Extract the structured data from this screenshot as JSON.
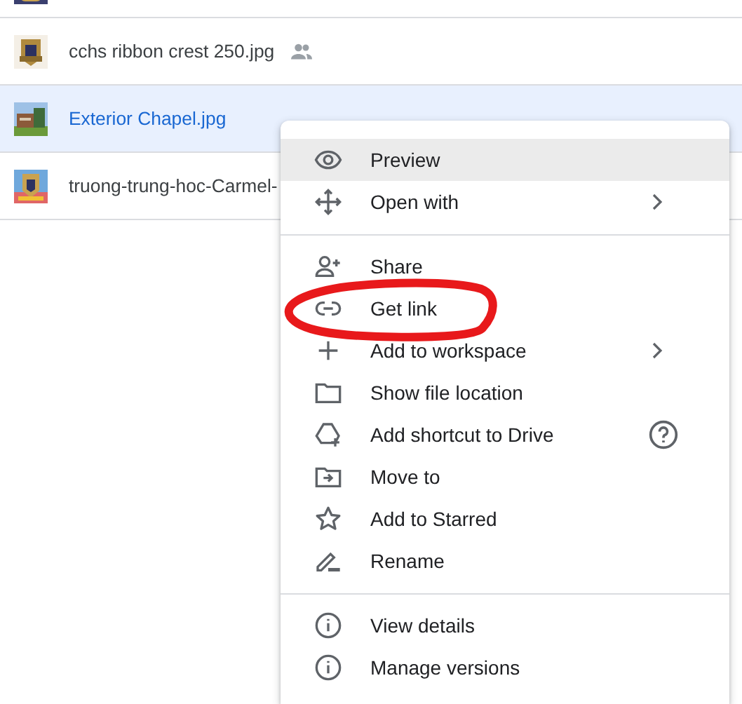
{
  "files": [
    {
      "selected": false,
      "partial": true
    },
    {
      "name": "cchs ribbon crest 250.jpg",
      "shared": true,
      "selected": false
    },
    {
      "name": "Exterior Chapel.jpg",
      "shared": false,
      "selected": true
    },
    {
      "name": "truong-trung-hoc-Carmel-",
      "selected": false
    }
  ],
  "menu": {
    "sections": [
      [
        {
          "label": "Preview",
          "selected": true,
          "submenu": false,
          "help": false,
          "circled": false
        },
        {
          "label": "Open with",
          "selected": false,
          "submenu": true,
          "help": false,
          "circled": false
        }
      ],
      [
        {
          "label": "Share",
          "selected": false,
          "submenu": false,
          "help": false,
          "circled": false
        },
        {
          "label": "Get link",
          "selected": false,
          "submenu": false,
          "help": false,
          "circled": true
        },
        {
          "label": "Add to workspace",
          "selected": false,
          "submenu": true,
          "help": false,
          "circled": false
        },
        {
          "label": "Show file location",
          "selected": false,
          "submenu": false,
          "help": false,
          "circled": false
        },
        {
          "label": "Add shortcut to Drive",
          "selected": false,
          "submenu": false,
          "help": true,
          "circled": false
        },
        {
          "label": "Move to",
          "selected": false,
          "submenu": false,
          "help": false,
          "circled": false
        },
        {
          "label": "Add to Starred",
          "selected": false,
          "submenu": false,
          "help": false,
          "circled": false
        },
        {
          "label": "Rename",
          "selected": false,
          "submenu": false,
          "help": false,
          "circled": false
        }
      ],
      [
        {
          "label": "View details",
          "selected": false,
          "submenu": false,
          "help": false,
          "circled": false
        },
        {
          "label": "Manage versions",
          "selected": false,
          "submenu": false,
          "help": false,
          "circled": false
        }
      ]
    ]
  }
}
